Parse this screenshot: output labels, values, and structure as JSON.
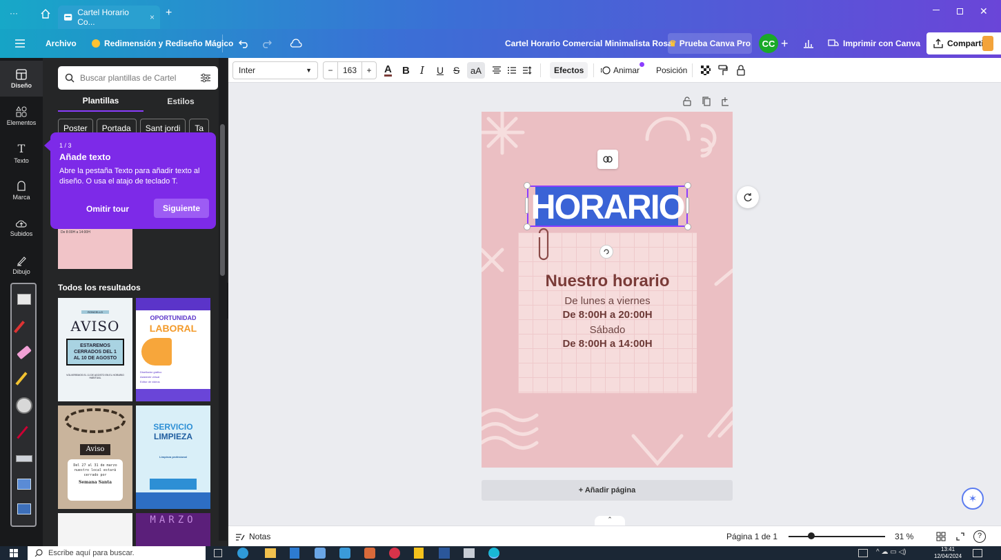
{
  "window": {
    "tab_title": "Cartel Horario Co...",
    "tab_close": "×",
    "new_tab": "+",
    "menu_dots": "···"
  },
  "header": {
    "file_menu": "Archivo",
    "magic_resize": "Redimensión y Rediseño Mágico",
    "doc_title": "Cartel Horario Comercial Minimalista Rosa",
    "try_pro": "Prueba Canva Pro",
    "avatar_initials": "CC",
    "print": "Imprimir con Canva",
    "share": "Compartir"
  },
  "toolbar": {
    "font_family": "Inter",
    "font_size": "163",
    "minus": "−",
    "plus": "+",
    "effects": "Efectos",
    "animate": "Animar",
    "position": "Posición"
  },
  "rail": {
    "items": [
      {
        "label": "Diseño"
      },
      {
        "label": "Elementos"
      },
      {
        "label": "Texto"
      },
      {
        "label": "Marca"
      },
      {
        "label": "Subidos"
      },
      {
        "label": "Dibujo"
      }
    ]
  },
  "panel": {
    "search_placeholder": "Buscar plantillas de Cartel",
    "tabs": [
      "Plantillas",
      "Estilos"
    ],
    "chips": [
      "Poster",
      "Portada",
      "Sant jordi",
      "Ta"
    ],
    "tour": {
      "step": "1 / 3",
      "title": "Añade texto",
      "body": "Abre la pestaña Texto para añadir texto al diseño. O usa el atajo de teclado T.",
      "skip": "Omitir tour",
      "next": "Siguiente"
    },
    "results_heading": "Todos los resultados",
    "templates": {
      "t1": {
        "small": "RONCELLO",
        "title": "AVISO",
        "body": "ESTAREMOS CERRADOS DEL 1 AL 10 DE AGOSTO",
        "foot": "VOLVEREMOS EL 11 DE AGOSTO EN EL HORARIO HABITUAL"
      },
      "t2": {
        "title1": "OPORTUNIDAD",
        "title2": "LABORAL",
        "items": [
          "Diseñador gráfico",
          "Asistente virtual",
          "Editor de videos"
        ]
      },
      "t3": {
        "title": "Aviso",
        "body": "Del 27 al 31 de marzo nuestro local estará cerrado por",
        "foot": "Semana Santa"
      },
      "t4": {
        "title1": "SERVICIO",
        "title2": "LIMPIEZA",
        "sub": "Limpieza profesional"
      },
      "t5": {
        "title": "MARZO"
      },
      "thumb_partial": "De 8:00H a 14:00H"
    }
  },
  "poster": {
    "heading_selected": "HORARIO",
    "subtitle": "Nuestro horario",
    "line1": "De lunes a viernes",
    "line2": "De 8:00H a 20:00H",
    "line3": "Sábado",
    "line4": "De 8:00H a 14:00H"
  },
  "canvas": {
    "add_page": "+ Añadir página"
  },
  "bottom": {
    "notes": "Notas",
    "page_indicator": "Página 1 de 1",
    "zoom": "31 %",
    "zoom_level": 0.31
  },
  "taskbar": {
    "search_placeholder": "Escribe aquí para buscar.",
    "time": "13:41",
    "date": "12/04/2024"
  },
  "colors": {
    "accent_purple": "#7d2ae8",
    "selection_blue": "#3a63d6",
    "poster_pink": "#ebbfc3",
    "heading_brown": "#7a3b38"
  }
}
